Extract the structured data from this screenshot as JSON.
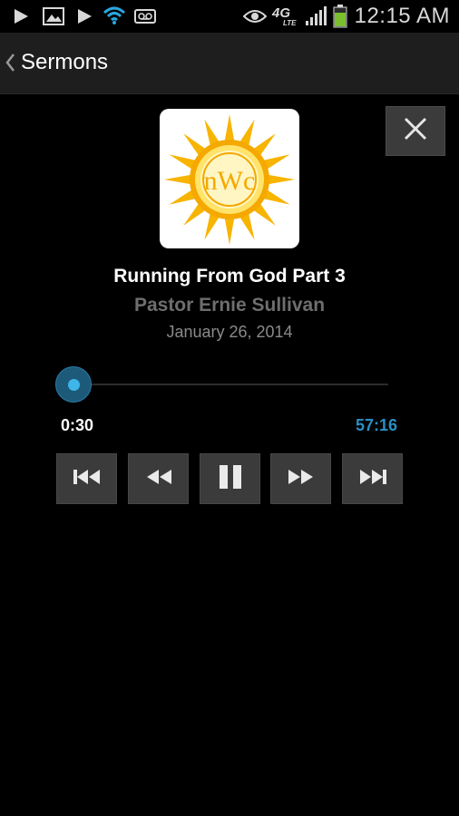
{
  "status_bar": {
    "time": "12:15 AM",
    "network": "4G",
    "network_sub": "LTE",
    "icons": [
      "play-icon",
      "gallery-icon",
      "play-store-icon",
      "wifi-icon",
      "voicemail-icon",
      "eye-icon",
      "network-4g-lte-icon",
      "signal-icon",
      "battery-icon"
    ]
  },
  "action_bar": {
    "title": "Sermons",
    "back_icon": "chevron-left-icon"
  },
  "player": {
    "artwork_text": "nWc",
    "title": "Running From God Part 3",
    "speaker": "Pastor Ernie Sullivan",
    "date": "January 26, 2014",
    "elapsed": "0:30",
    "total": "57:16",
    "progress_fraction": 0.0087,
    "close_icon": "close-icon",
    "controls": [
      {
        "name": "skip-previous-button",
        "icon": "skip-previous-icon"
      },
      {
        "name": "rewind-button",
        "icon": "rewind-icon"
      },
      {
        "name": "pause-button",
        "icon": "pause-icon"
      },
      {
        "name": "fast-forward-button",
        "icon": "fast-forward-icon"
      },
      {
        "name": "skip-next-button",
        "icon": "skip-next-icon"
      }
    ]
  },
  "colors": {
    "accent": "#33b5e5",
    "total_time": "#2a8fc4",
    "button_bg": "#3b3b3b",
    "sun": "#f7b400"
  }
}
